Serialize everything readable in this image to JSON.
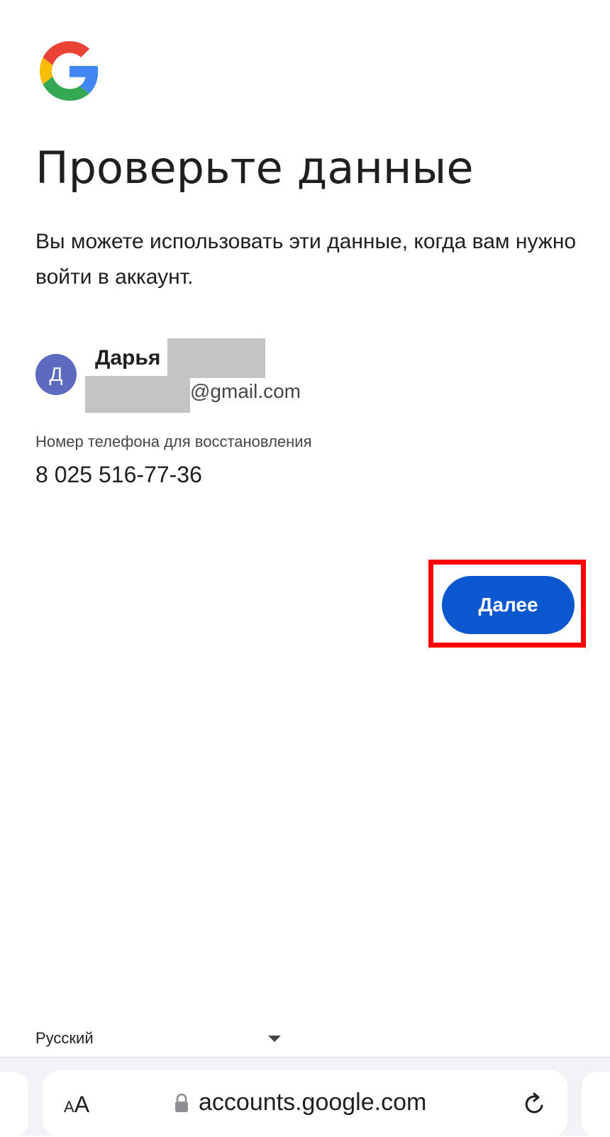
{
  "page": {
    "title": "Проверьте данные",
    "subtitle": "Вы можете использовать эти данные, когда вам нужно войти в аккаунт."
  },
  "account": {
    "avatar_letter": "Д",
    "name": "Дарья",
    "email_suffix": "@gmail.com",
    "avatar_color": "#5c6bc0"
  },
  "recovery": {
    "label": "Номер телефона для восстановления",
    "phone": "8 025 516-77-36"
  },
  "actions": {
    "next_label": "Далее",
    "accent_color": "#0b57d0"
  },
  "footer": {
    "language": "Русский"
  },
  "browser": {
    "aa_small": "A",
    "aa_large": "A",
    "url": "accounts.google.com"
  },
  "icons": {
    "logo": "google-g-logo",
    "lock": "lock-icon",
    "reload": "reload-icon",
    "dropdown": "caret-down-icon"
  }
}
